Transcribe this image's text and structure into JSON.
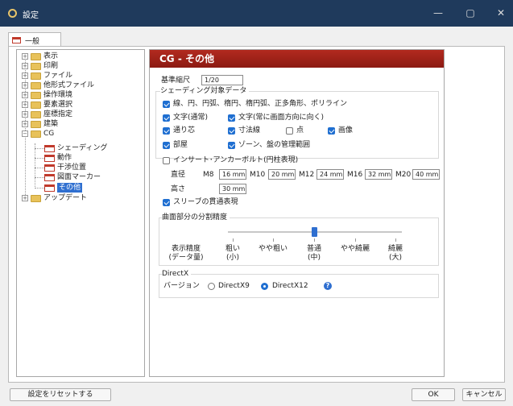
{
  "window": {
    "title": "設定",
    "minimize": "—",
    "maximize": "▢",
    "close": "✕"
  },
  "tab": {
    "label": "一般"
  },
  "tree": {
    "items": [
      {
        "label": "表示"
      },
      {
        "label": "印刷"
      },
      {
        "label": "ファイル"
      },
      {
        "label": "他形式ファイル"
      },
      {
        "label": "操作環境"
      },
      {
        "label": "要素選択"
      },
      {
        "label": "座標指定"
      },
      {
        "label": "建築"
      },
      {
        "label": "CG"
      },
      {
        "label": "アップデート"
      }
    ],
    "cg_children": [
      {
        "label": "シェーディング"
      },
      {
        "label": "動作"
      },
      {
        "label": "干渉位置"
      },
      {
        "label": "図面マーカー"
      },
      {
        "label": "その他"
      }
    ],
    "expand_plus": "+",
    "expand_minus": "−"
  },
  "header": {
    "title": "CG - その他"
  },
  "scale": {
    "label": "基準縮尺",
    "value": "1/20"
  },
  "shading_group": {
    "label": "シェーディング対象データ",
    "line_items": "線、円、円弧、楕円、楕円弧、正多角形、ポリライン",
    "text_normal": "文字(通常)",
    "text_facing": "文字(常に画面方向に向く)",
    "core": "通り芯",
    "dimension": "寸法線",
    "point": "点",
    "image": "画像",
    "room": "部屋",
    "zone": "ゾーン、盤の管理範囲"
  },
  "insert_anchor": {
    "label": "インサート･アンカーボルト(円柱表現)",
    "diameter_label": "直径",
    "sizes": [
      {
        "label": "M8",
        "value": "16 mm"
      },
      {
        "label": "M10",
        "value": "20 mm"
      },
      {
        "label": "M12",
        "value": "24 mm"
      },
      {
        "label": "M16",
        "value": "32 mm"
      },
      {
        "label": "M20",
        "value": "40 mm"
      }
    ],
    "height_label": "高さ",
    "height_value": "30 mm"
  },
  "sleeve": {
    "label": "スリーブの貫通表現"
  },
  "curve": {
    "label": "曲面部分の分割精度",
    "row_label": [
      "表示精度",
      "(データ量)"
    ],
    "levels": [
      {
        "line1": "粗い",
        "line2": "(小)"
      },
      {
        "line1": "やや粗い",
        "line2": ""
      },
      {
        "line1": "普通",
        "line2": "(中)"
      },
      {
        "line1": "やや綺麗",
        "line2": ""
      },
      {
        "line1": "綺麗",
        "line2": "(大)"
      }
    ],
    "selected_index": 2
  },
  "directx": {
    "label": "DirectX",
    "version_label": "バージョン",
    "options": [
      "DirectX9",
      "DirectX12"
    ],
    "selected": "DirectX12",
    "help": "?"
  },
  "footer": {
    "reset": "設定をリセットする",
    "ok": "OK",
    "cancel": "キャンセル"
  },
  "colors": {
    "accent": "#1f6fd1",
    "header_red": "#a82418",
    "titlebar": "#1f3a5c"
  }
}
